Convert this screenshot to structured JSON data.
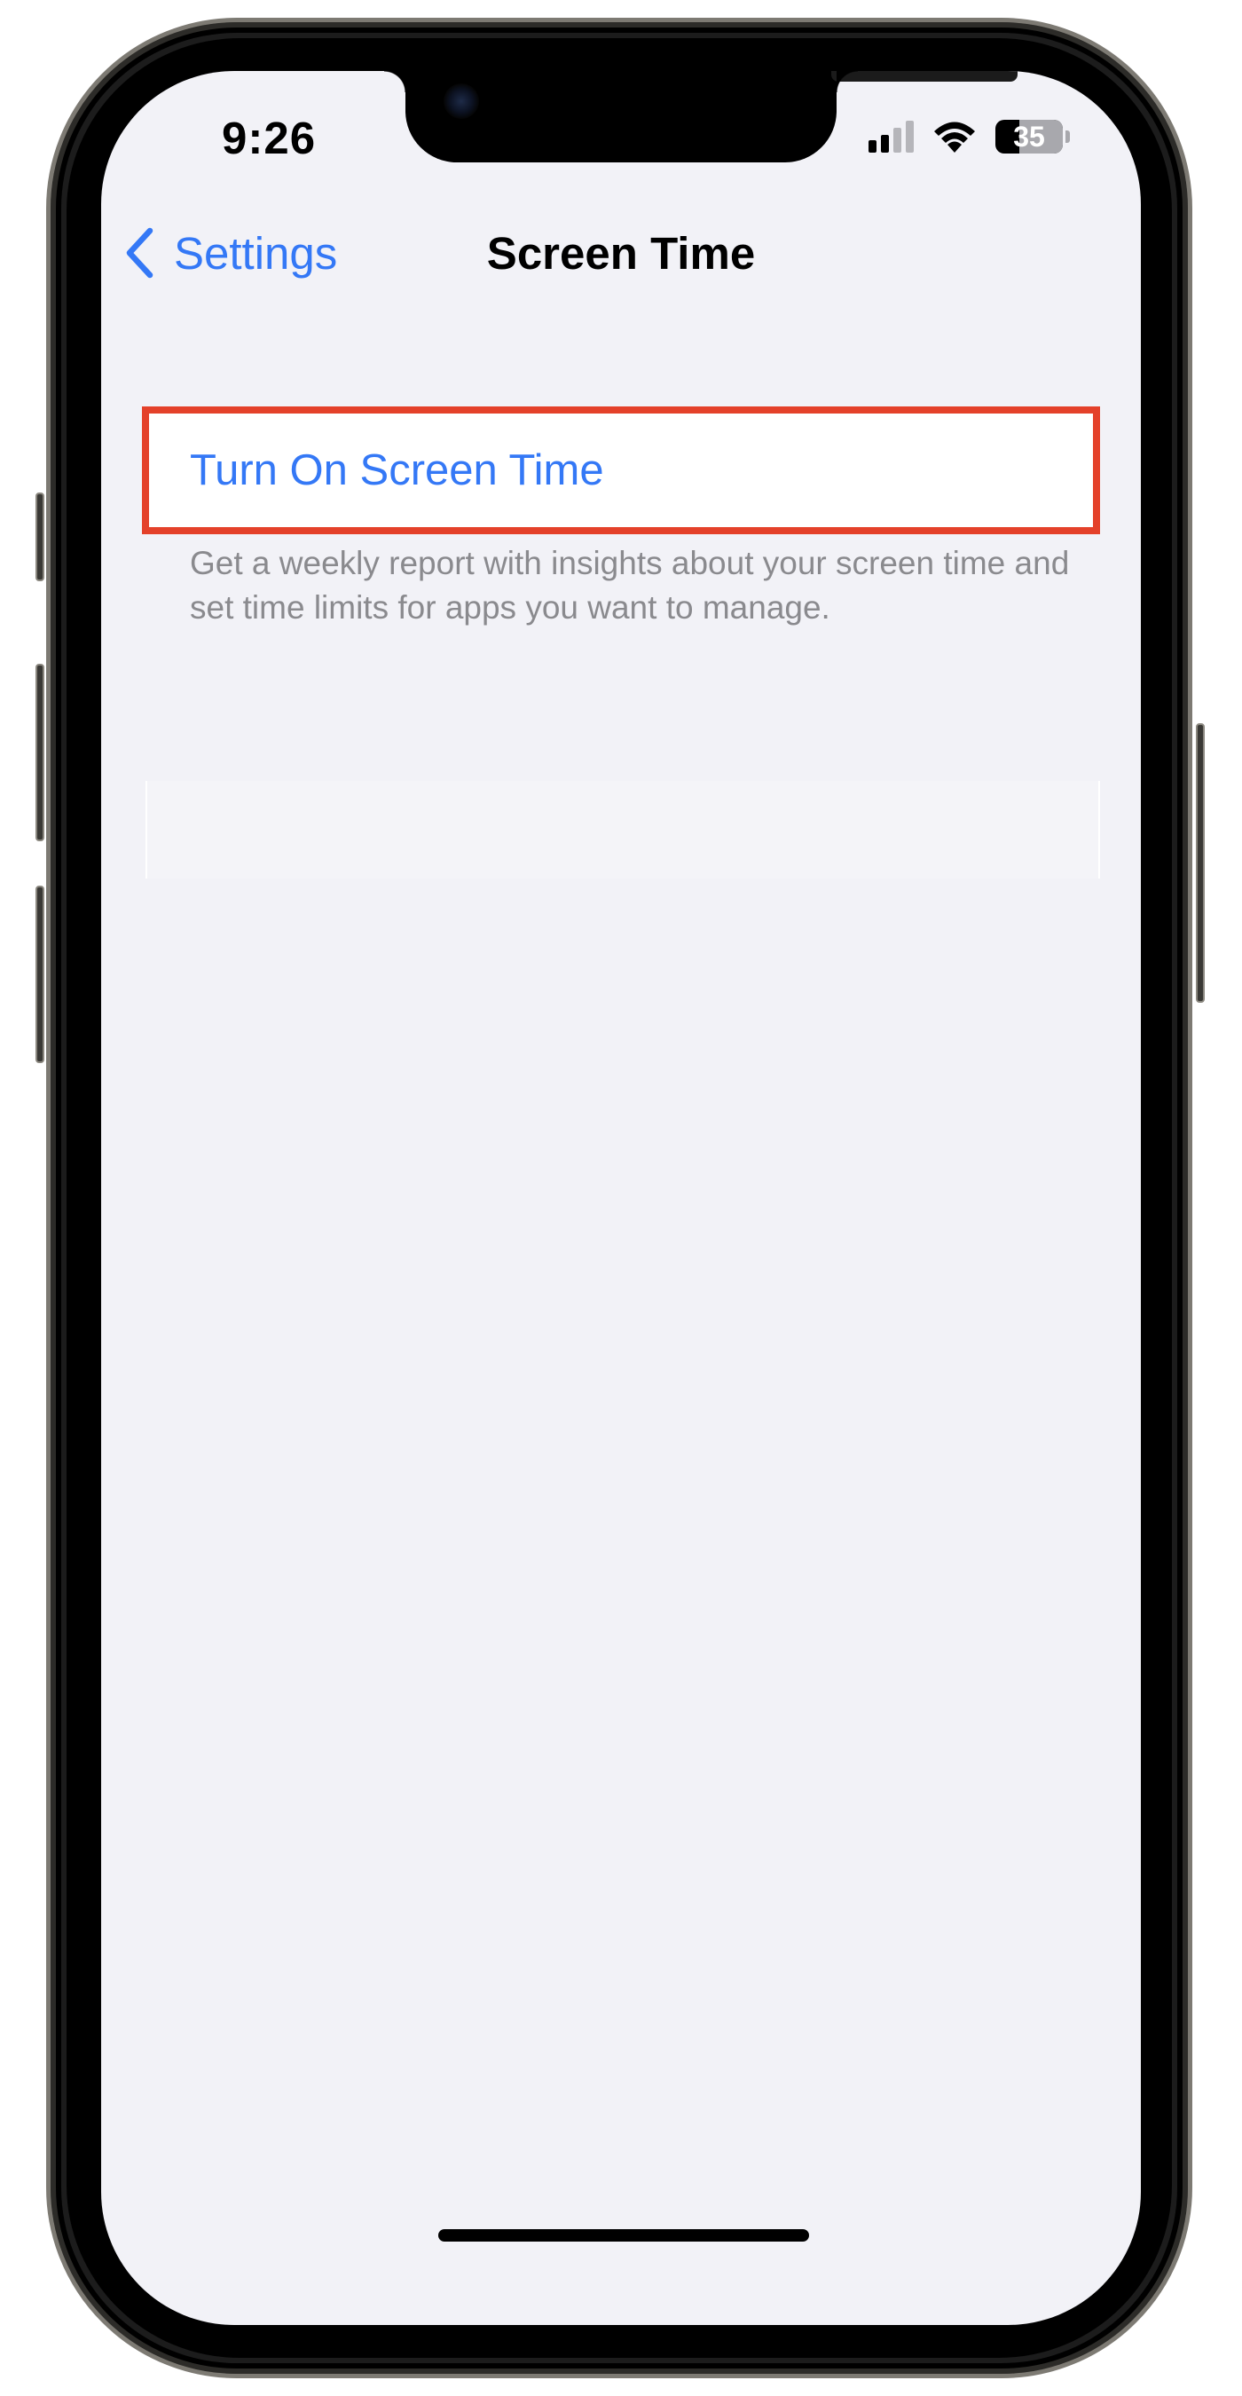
{
  "status_bar": {
    "time": "9:26",
    "battery_level": "35",
    "signal_bars_active": 2,
    "signal_bars_total": 4
  },
  "nav": {
    "back_label": "Settings",
    "title": "Screen Time"
  },
  "content": {
    "turn_on_label": "Turn On Screen Time",
    "description": "Get a weekly report with insights about your screen time and set time limits for apps you want to manage."
  },
  "colors": {
    "accent": "#3478f6",
    "highlight_border": "#e4412a",
    "background": "#f2f2f7",
    "secondary_text": "#8a8a8e"
  },
  "icons": {
    "back": "chevron-left-icon",
    "signal": "cellular-signal-icon",
    "wifi": "wifi-icon",
    "battery": "battery-icon"
  }
}
